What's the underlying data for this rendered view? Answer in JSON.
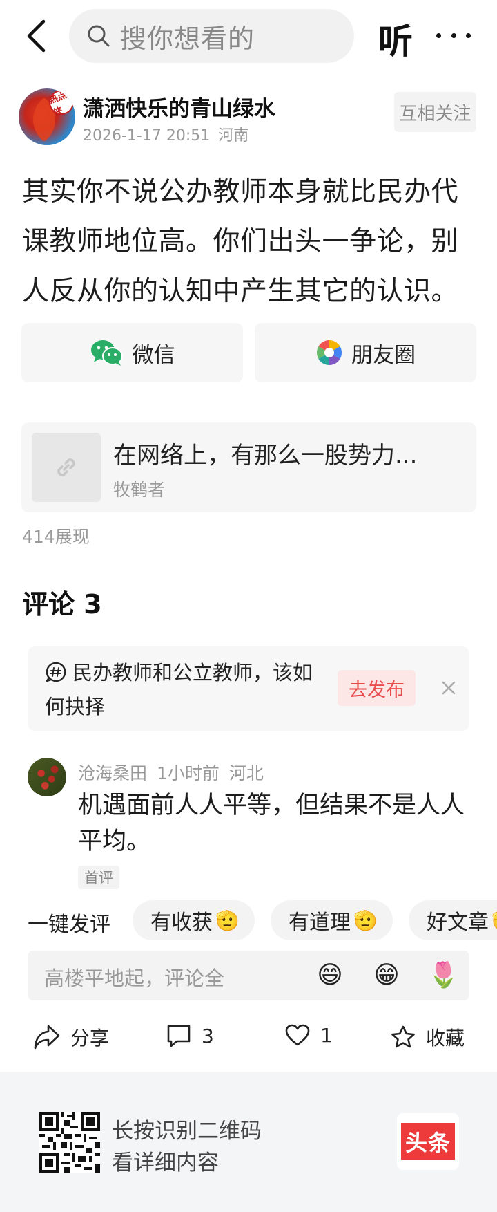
{
  "header": {
    "search_placeholder": "搜你想看的",
    "listen_label": "听"
  },
  "author": {
    "name": "潇洒快乐的青山绿水",
    "avatar_stamp": "热点侠",
    "date": "2026-1-17 20:51",
    "location": "河南",
    "follow_label": "互相关注"
  },
  "post": {
    "text": "其实你不说公办教师本身就比民办代课教师地位高。你们出头一争论，别人反从你的认知中产生其它的认识。"
  },
  "share": {
    "wechat_label": "微信",
    "moments_label": "朋友圈"
  },
  "linked_article": {
    "title": "在网络上，有那么一股势力...",
    "author": "牧鹤者"
  },
  "impressions": "414展现",
  "comments": {
    "title": "评论 3",
    "topic": {
      "text": "民办教师和公立教师，该如何抉择",
      "publish_label": "去发布"
    },
    "items": [
      {
        "user": "沧海桑田",
        "time": "1小时前",
        "location": "河北",
        "text": "机遇面前人人平等，但结果不是人人平均。",
        "badge": "首评"
      }
    ]
  },
  "quick_reply": {
    "label": "一键发评",
    "chips": [
      "有收获",
      "有道理",
      "好文章"
    ],
    "chip_emoji": "🫡"
  },
  "comment_input": {
    "placeholder": "高楼平地起，评论全",
    "emojis": [
      "😄",
      "😁",
      "🌷"
    ]
  },
  "actions": {
    "share_label": "分享",
    "comment_count": "3",
    "like_count": "1",
    "favorite_label": "收藏"
  },
  "footer": {
    "line1": "长按识别二维码",
    "line2": "看详细内容",
    "logo_text": "头条"
  },
  "colors": {
    "accent_red": "#ed3a3a",
    "publish_bg": "#fde6e6",
    "wechat_green": "#2aae67"
  }
}
